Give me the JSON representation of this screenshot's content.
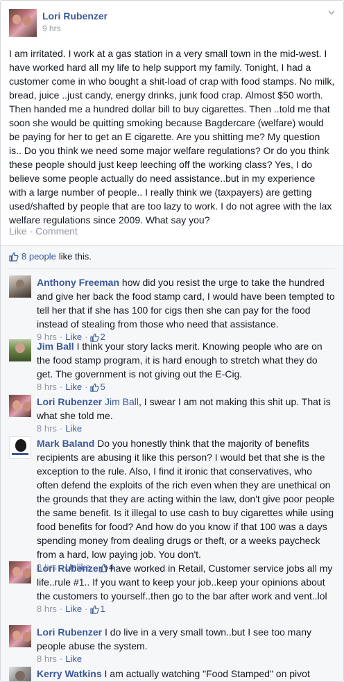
{
  "post": {
    "author": "Lori Rubenzer",
    "time": "9 hrs",
    "text": "I am irritated. I work at a gas station in a very small town in the mid-west. I have worked hard all my life to help support my family. Tonight, I had a customer come in who bought a shit-load of crap with food stamps. No milk, bread, juice ..just candy, energy drinks, junk food crap. Almost $50 worth. Then handed me a hundred dollar bill to buy cigarettes. Then ..told me that soon she would be quitting smoking because Bagdercare (welfare) would be paying for her to get an E cigarette. Are you shitting me? My question is.. Do you think we need some major welfare regulations? Or do you think these people should just keep leeching off the working class? Yes, I do believe some people actually do need assistance..but in my experience with a large number of people.. I really think we (taxpayers) are getting used/shafted by people that are too lazy to work. I do not agree with the lax welfare regulations since 2009. What say you?",
    "actions": {
      "like": "Like",
      "separator": "·",
      "comment": "Comment"
    }
  },
  "likes": {
    "people": "8 people",
    "rest": "like this."
  },
  "comments": [
    {
      "author": "Anthony Freeman",
      "text": "how did you resist the urge to take the hundred and give her back the food stamp card, I would have been tempted to tell her that if she has 100 for cigs then she can pay for the food instead of stealing from those who need that assistance.",
      "time": "9 hrs",
      "like_label": "Like",
      "likes": "2",
      "avatar": "avatar-anthony"
    },
    {
      "author": "Jim Ball",
      "text": "I think your story lacks merit. Knowing people who are on the food stamp program, it is hard enough to stretch what they do get. The government is not giving out the E-Cig.",
      "time": "8 hrs",
      "like_label": "Like",
      "likes": "5",
      "avatar": "avatar-jim"
    },
    {
      "author": "Lori Rubenzer",
      "tag": "Jim Ball",
      "text": ", I swear I am not making this shit up. That is what she told me.",
      "time": "8 hrs",
      "like_label": "Like",
      "avatar": "avatar-lori"
    },
    {
      "author": "Mark Baland",
      "text": "Do you honestly think that the majority of benefits recipients are abusing it like this person? I would bet that she is the exception to the rule. Also, I find it ironic that conservatives, who often defend the exploits of the rich even when they are unethical on the grounds that they are acting within the law, don't give poor people the same benefit. Is it illegal to use cash to buy cigarettes while using food benefits for food? And how do you know if that 100 was a days spending money from dealing drugs or theft, or a weeks paycheck from a hard, low paying job. You don't.",
      "time": "8 hrs",
      "like_label": "Unlike",
      "likes": "4",
      "avatar": "avatar-mark"
    },
    {
      "author": "Lori Rubenzer",
      "text": "I have worked in Retail, Customer service jobs all my life..rule #1.. If you want to keep your job..keep your opinions about the customers to yourself..then go to the bar after work and vent..lol",
      "time": "8 hrs",
      "like_label": "Like",
      "likes": "1",
      "avatar": "avatar-lori"
    },
    {
      "author": "Lori Rubenzer",
      "text": "I do live in a very small town..but I see too many people abuse the system.",
      "time": "8 hrs",
      "like_label": "Like",
      "avatar": "avatar-lori"
    },
    {
      "author": "Kerry Watkins",
      "text": "I am actually watching \"Food Stamped\" on pivot",
      "avatar": "avatar-kerry"
    }
  ],
  "colors": {
    "link": "#3b5998",
    "meta": "#9197a3",
    "text": "#141823",
    "comment_bg": "#f6f7f9"
  }
}
